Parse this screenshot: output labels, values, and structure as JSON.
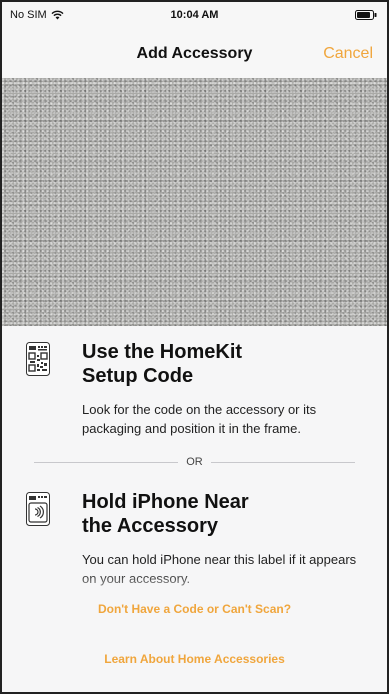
{
  "status_bar": {
    "carrier": "No SIM",
    "time": "10:04 AM"
  },
  "nav": {
    "title": "Add Accessory",
    "cancel_label": "Cancel"
  },
  "options": [
    {
      "icon": "qr-code-icon",
      "title_line1": "Use the HomeKit",
      "title_line2": "Setup Code",
      "description": "Look for the code on the accessory or its packaging and position it in the frame."
    },
    {
      "icon": "nfc-tag-icon",
      "title_line1": "Hold iPhone Near",
      "title_line2": "the Accessory",
      "description": "You can hold iPhone near this label if it appears on your accessory."
    }
  ],
  "divider_text": "OR",
  "links": {
    "no_code": "Don't Have a Code or Can't Scan?",
    "learn": "Learn About Home Accessories"
  },
  "colors": {
    "accent": "#f0a63d",
    "background": "#f6f6f7"
  }
}
